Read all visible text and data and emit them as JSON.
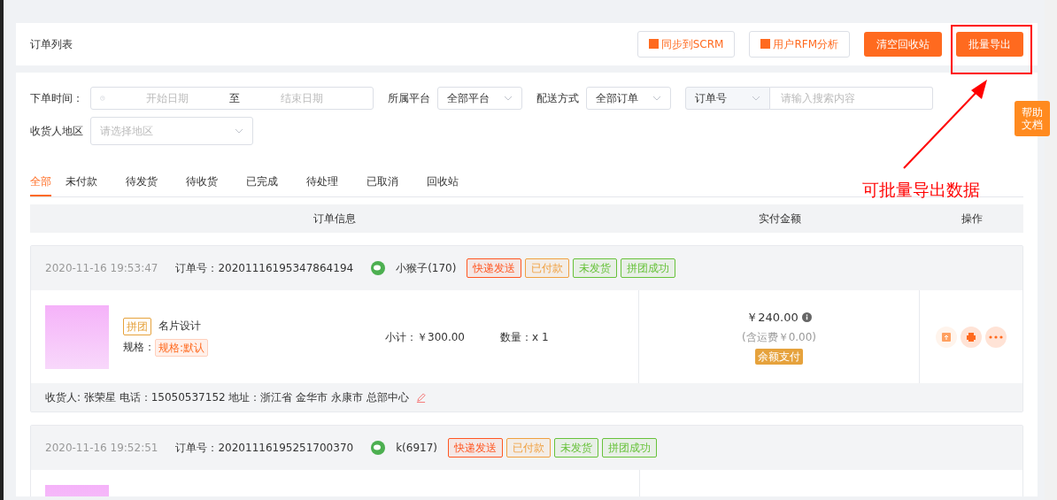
{
  "header": {
    "title": "订单列表",
    "buttons": [
      {
        "label": "同步到SCRM",
        "kind": "outline"
      },
      {
        "label": "用户RFM分析",
        "kind": "outline"
      },
      {
        "label": "清空回收站",
        "kind": "solid"
      },
      {
        "label": "批量导出",
        "kind": "solid"
      }
    ]
  },
  "filters": {
    "time_label": "下单时间：",
    "start_placeholder": "开始日期",
    "to": "至",
    "end_placeholder": "结束日期",
    "platform_label": "所属平台",
    "platform": "全部平台",
    "delivery_label": "配送方式",
    "delivery": "全部订单",
    "search_type": "订单号",
    "search_placeholder": "请输入搜索内容",
    "region_label": "收货人地区",
    "region_placeholder": "请选择地区"
  },
  "tabs": [
    {
      "label": "全部",
      "selected": true
    },
    {
      "label": "未付款",
      "selected": false
    },
    {
      "label": "待发货",
      "selected": false
    },
    {
      "label": "待收货",
      "selected": false
    },
    {
      "label": "已完成",
      "selected": false
    },
    {
      "label": "待处理",
      "selected": false
    },
    {
      "label": "已取消",
      "selected": false
    },
    {
      "label": "回收站",
      "selected": false
    }
  ],
  "table": {
    "columns": [
      "订单信息",
      "实付金额",
      "操作"
    ]
  },
  "orders": [
    {
      "time": "2020-11-16 19:53:47",
      "order_no_label": "订单号：",
      "order_no": "20201116195347864194",
      "buyer": "小猴子(170)",
      "tags": [
        {
          "label": "快递发送",
          "color": "#ff5722"
        },
        {
          "label": "已付款",
          "color": "#f0a040"
        },
        {
          "label": "未发货",
          "color": "#67c23a"
        },
        {
          "label": "拼团成功",
          "color": "#67c23a"
        }
      ],
      "product": {
        "group_tag": "拼团",
        "name": "名片设计",
        "spec_label": "规格：",
        "spec": "规格:默认",
        "subtotal": "小计：￥300.00",
        "quantity": "数量：x 1"
      },
      "price": "￥240.00",
      "shipping": "(含运费￥0.00)",
      "payment": "余额支付",
      "address": "收货人: 张荣星 电话：15050537152 地址：浙江省 金华市 永康市 总部中心"
    },
    {
      "time": "2020-11-16 19:52:51",
      "order_no_label": "订单号：",
      "order_no": "20201116195251700370",
      "buyer": "k(6917)",
      "tags": [
        {
          "label": "快递发送",
          "color": "#ff5722"
        },
        {
          "label": "已付款",
          "color": "#f0a040"
        },
        {
          "label": "未发货",
          "color": "#67c23a"
        },
        {
          "label": "拼团成功",
          "color": "#67c23a"
        }
      ]
    }
  ],
  "help": {
    "label": "帮助文档"
  },
  "annotation": {
    "text": "可批量导出数据"
  }
}
